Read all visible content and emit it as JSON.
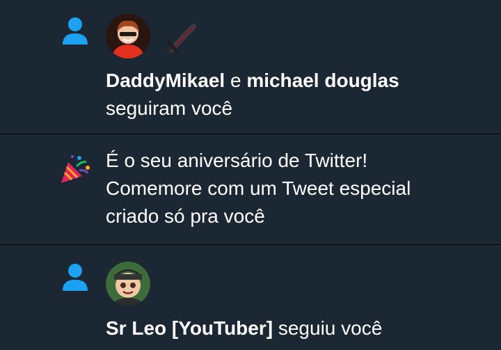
{
  "notifications": [
    {
      "type": "follow",
      "icon": "person-icon",
      "users": [
        "DaddyMikael",
        "michael douglas"
      ],
      "connector": " e ",
      "action": "seguiram você"
    },
    {
      "type": "anniversary",
      "icon": "party-popper-icon",
      "lines": [
        "É o seu aniversário de Twitter!",
        "Comemore com um Tweet especial",
        "criado só pra você"
      ]
    },
    {
      "type": "follow",
      "icon": "person-icon",
      "user": "Sr Leo [YouTuber]",
      "action": " seguiu você"
    }
  ],
  "colors": {
    "background": "#1b2733",
    "accent": "#1da1f2",
    "text": "#ffffff",
    "divider": "#000000"
  }
}
